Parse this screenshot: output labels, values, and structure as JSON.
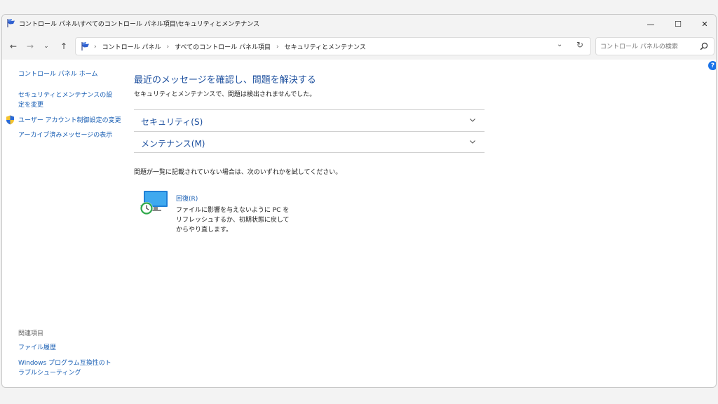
{
  "window": {
    "title": "コントロール パネル\\すべてのコントロール パネル項目\\セキュリティとメンテナンス",
    "controls": {
      "minimize": "—",
      "maximize": "☐",
      "close": "✕"
    }
  },
  "nav": {
    "back": "←",
    "forward": "→",
    "recent": "⌄",
    "up": "↑"
  },
  "address": {
    "breadcrumbs": [
      "コントロール パネル",
      "すべてのコントロール パネル項目",
      "セキュリティとメンテナンス"
    ],
    "separator": "›",
    "dropdown": "⌄",
    "refresh": "↻"
  },
  "search": {
    "placeholder": "コントロール パネルの検索",
    "value": ""
  },
  "help": "?",
  "left": {
    "home": "コントロール パネル ホーム",
    "change_settings": "セキュリティとメンテナンスの設定を変更",
    "uac": "ユーザー アカウント制御設定の変更",
    "archived": "アーカイブ済みメッセージの表示",
    "related_label": "関連項目",
    "file_history": "ファイル履歴",
    "troubleshoot": "Windows プログラム互換性のトラブルシューティング"
  },
  "main": {
    "title": "最近のメッセージを確認し、問題を解決する",
    "subtitle": "セキュリティとメンテナンスで、問題は検出されませんでした。",
    "sections": [
      {
        "label": "セキュリティ(S)"
      },
      {
        "label": "メンテナンス(M)"
      }
    ],
    "hint": "問題が一覧に記載されていない場合は、次のいずれかを試してください。",
    "recovery": {
      "label": "回復(R)",
      "description": "ファイルに影響を与えないように PC をリフレッシュするか、初期状態に戻してからやり直します。"
    }
  },
  "colors": {
    "link": "#1a5fb4",
    "heading": "#1c4f9e",
    "help": "#1a73e8"
  },
  "icons": [
    "flag-icon",
    "search-icon",
    "shield-icon",
    "chevron-down-icon",
    "recovery-icon"
  ]
}
